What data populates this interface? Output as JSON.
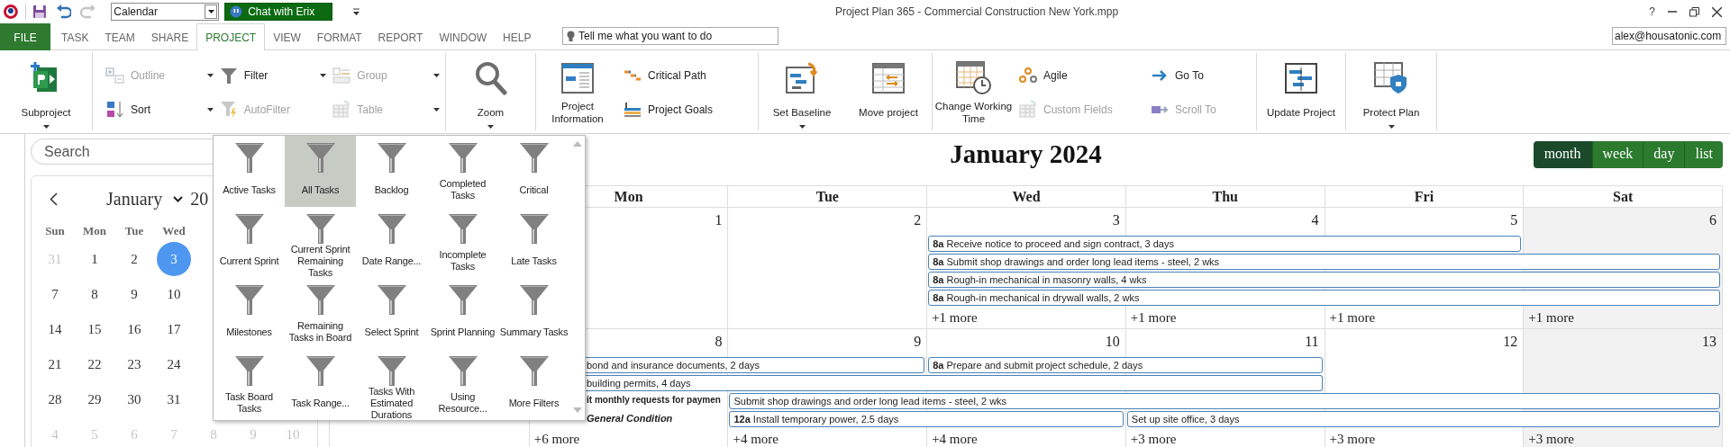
{
  "quick_access": {
    "view_select": {
      "value": "Calendar"
    },
    "chat_button": {
      "label": "Chat with Erix"
    }
  },
  "window": {
    "title": "Project Plan 365 - Commercial Construction New York.mpp",
    "help": "?"
  },
  "tabs": [
    {
      "label": "FILE",
      "kind": "file",
      "selected": false
    },
    {
      "label": "TASK",
      "kind": "tab",
      "selected": false
    },
    {
      "label": "TEAM",
      "kind": "tab",
      "selected": false
    },
    {
      "label": "SHARE",
      "kind": "tab",
      "selected": false
    },
    {
      "label": "PROJECT",
      "kind": "tab",
      "selected": true
    },
    {
      "label": "VIEW",
      "kind": "tab",
      "selected": false
    },
    {
      "label": "FORMAT",
      "kind": "tab",
      "selected": false
    },
    {
      "label": "REPORT",
      "kind": "tab",
      "selected": false
    },
    {
      "label": "WINDOW",
      "kind": "tab",
      "selected": false
    },
    {
      "label": "HELP",
      "kind": "tab",
      "selected": false
    }
  ],
  "tell_me": {
    "placeholder": "Tell me what you want to do"
  },
  "account": {
    "value": "alex@housatonic.com"
  },
  "ribbon": {
    "groups": [
      {
        "items": [
          {
            "label": "Subproject",
            "kind": "large",
            "disabled": false,
            "dropdown": true
          }
        ]
      },
      {
        "items": [
          {
            "label": "Outline",
            "kind": "small",
            "disabled": true,
            "dropdown": true
          },
          {
            "label": "Sort",
            "kind": "small",
            "disabled": false,
            "dropdown": true
          },
          {
            "label": "Filter",
            "kind": "small",
            "disabled": false,
            "dropdown": true
          },
          {
            "label": "AutoFilter",
            "kind": "small",
            "disabled": true,
            "dropdown": false
          },
          {
            "label": "Group",
            "kind": "small",
            "disabled": true,
            "dropdown": true
          },
          {
            "label": "Table",
            "kind": "small",
            "disabled": true,
            "dropdown": true
          }
        ]
      },
      {
        "items": [
          {
            "label": "Zoom",
            "kind": "large",
            "disabled": false,
            "dropdown": true
          }
        ]
      },
      {
        "items": [
          {
            "label": "Project Information",
            "kind": "large",
            "disabled": false,
            "dropdown": false
          },
          {
            "label": "Critical Path",
            "kind": "small",
            "disabled": false,
            "dropdown": false
          },
          {
            "label": "Project Goals",
            "kind": "small",
            "disabled": false,
            "dropdown": false
          }
        ]
      },
      {
        "items": [
          {
            "label": "Set Baseline",
            "kind": "large",
            "disabled": false,
            "dropdown": true
          },
          {
            "label": "Move project",
            "kind": "large",
            "disabled": false,
            "dropdown": false
          }
        ]
      },
      {
        "items": [
          {
            "label": "Change Working Time",
            "kind": "large",
            "disabled": false,
            "dropdown": false
          },
          {
            "label": "Agile",
            "kind": "small",
            "disabled": false,
            "dropdown": false
          },
          {
            "label": "Custom Fields",
            "kind": "small",
            "disabled": true,
            "dropdown": false
          },
          {
            "label": "Go To",
            "kind": "small",
            "disabled": false,
            "dropdown": false
          },
          {
            "label": "Scroll To",
            "kind": "small",
            "disabled": true,
            "dropdown": false
          }
        ]
      },
      {
        "items": [
          {
            "label": "Update Project",
            "kind": "large",
            "disabled": false,
            "dropdown": false
          }
        ]
      },
      {
        "items": [
          {
            "label": "Protect Plan",
            "kind": "large",
            "disabled": false,
            "dropdown": true
          }
        ]
      }
    ]
  },
  "filter_menu": {
    "items": [
      {
        "label": "Active Tasks",
        "selected": false
      },
      {
        "label": "All Tasks",
        "selected": true
      },
      {
        "label": "Backlog",
        "selected": false
      },
      {
        "label": "Completed Tasks",
        "selected": false
      },
      {
        "label": "Critical",
        "selected": false
      },
      {
        "label": "Current Sprint",
        "selected": false
      },
      {
        "label": "Current Sprint Remaining Tasks",
        "selected": false
      },
      {
        "label": "Date Range...",
        "selected": false
      },
      {
        "label": "Incomplete Tasks",
        "selected": false
      },
      {
        "label": "Late Tasks",
        "selected": false
      },
      {
        "label": "Milestones",
        "selected": false
      },
      {
        "label": "Remaining Tasks in Board",
        "selected": false
      },
      {
        "label": "Select Sprint",
        "selected": false
      },
      {
        "label": "Sprint Planning",
        "selected": false
      },
      {
        "label": "Summary Tasks",
        "selected": false
      },
      {
        "label": "Task Board Tasks",
        "selected": false
      },
      {
        "label": "Task Range...",
        "selected": false
      },
      {
        "label": "Tasks With Estimated Durations",
        "selected": false
      },
      {
        "label": "Using Resource...",
        "selected": false
      },
      {
        "label": "More Filters",
        "selected": false
      }
    ]
  },
  "sidebar": {
    "search": {
      "placeholder": "Search"
    },
    "mini_calendar": {
      "month": "January",
      "year": "20",
      "weekdays": [
        "Sun",
        "Mon",
        "Tue",
        "Wed"
      ],
      "weeks": [
        {
          "days": [
            {
              "label": "31",
              "muted": true,
              "selected": false
            },
            {
              "label": "1",
              "muted": false,
              "selected": false
            },
            {
              "label": "2",
              "muted": false,
              "selected": false
            },
            {
              "label": "3",
              "muted": false,
              "selected": true
            }
          ]
        },
        {
          "days": [
            {
              "label": "7",
              "muted": false,
              "selected": false
            },
            {
              "label": "8",
              "muted": false,
              "selected": false
            },
            {
              "label": "9",
              "muted": false,
              "selected": false
            },
            {
              "label": "10",
              "muted": false,
              "selected": false
            }
          ]
        },
        {
          "days": [
            {
              "label": "14",
              "muted": false,
              "selected": false
            },
            {
              "label": "15",
              "muted": false,
              "selected": false
            },
            {
              "label": "16",
              "muted": false,
              "selected": false
            },
            {
              "label": "17",
              "muted": false,
              "selected": false
            }
          ]
        },
        {
          "days": [
            {
              "label": "21",
              "muted": false,
              "selected": false
            },
            {
              "label": "22",
              "muted": false,
              "selected": false
            },
            {
              "label": "23",
              "muted": false,
              "selected": false
            },
            {
              "label": "24",
              "muted": false,
              "selected": false
            }
          ]
        },
        {
          "days": [
            {
              "label": "28",
              "muted": false,
              "selected": false
            },
            {
              "label": "29",
              "muted": false,
              "selected": false
            },
            {
              "label": "30",
              "muted": false,
              "selected": false
            },
            {
              "label": "31",
              "muted": false,
              "selected": false
            }
          ]
        },
        {
          "days": [
            {
              "label": "4",
              "muted": true,
              "selected": false
            },
            {
              "label": "5",
              "muted": true,
              "selected": false
            },
            {
              "label": "6",
              "muted": true,
              "selected": false
            },
            {
              "label": "7",
              "muted": true,
              "selected": false
            },
            {
              "label": "8",
              "muted": true,
              "selected": false
            },
            {
              "label": "9",
              "muted": true,
              "selected": false
            },
            {
              "label": "10",
              "muted": true,
              "selected": false
            }
          ]
        }
      ]
    }
  },
  "calendar": {
    "title": "January 2024",
    "views": [
      {
        "label": "month",
        "selected": true
      },
      {
        "label": "week",
        "selected": false
      },
      {
        "label": "day",
        "selected": false
      },
      {
        "label": "list",
        "selected": false
      }
    ],
    "weekdays": [
      "Mon",
      "Tue",
      "Wed",
      "Thu",
      "Fri",
      "Sat"
    ],
    "weeks": [
      {
        "days": [
          {
            "number": "1",
            "weekend": false
          },
          {
            "number": "2",
            "weekend": false
          },
          {
            "number": "3",
            "weekend": false,
            "more": "+1 more"
          },
          {
            "number": "4",
            "weekend": false,
            "more": "+1 more"
          },
          {
            "number": "5",
            "weekend": false,
            "more": "+1 more"
          },
          {
            "number": "6",
            "weekend": true,
            "more": "+1 more"
          }
        ],
        "lanes": [
          {
            "cells": [
              {
                "kind": "empty"
              },
              {
                "kind": "empty"
              },
              {
                "kind": "empty"
              },
              {
                "kind": "bar",
                "time": "8a",
                "title": "Receive notice to proceed and sign contract, 3 days"
              },
              {
                "kind": "continue"
              },
              {
                "kind": "continue"
              },
              {
                "kind": "empty"
              }
            ]
          },
          {
            "cells": [
              {
                "kind": "empty"
              },
              {
                "kind": "empty"
              },
              {
                "kind": "empty"
              },
              {
                "kind": "bar",
                "time": "8a",
                "title": "Submit shop drawings and order long lead items - steel, 2 wks"
              },
              {
                "kind": "continue"
              },
              {
                "kind": "continue"
              },
              {
                "kind": "continue"
              }
            ]
          },
          {
            "cells": [
              {
                "kind": "empty"
              },
              {
                "kind": "empty"
              },
              {
                "kind": "empty"
              },
              {
                "kind": "bar",
                "time": "8a",
                "title": "Rough-in mechanical in masonry walls, 4 wks"
              },
              {
                "kind": "continue"
              },
              {
                "kind": "continue"
              },
              {
                "kind": "continue"
              }
            ]
          },
          {
            "cells": [
              {
                "kind": "empty"
              },
              {
                "kind": "empty"
              },
              {
                "kind": "empty"
              },
              {
                "kind": "bar",
                "time": "8a",
                "title": "Rough-in mechanical in drywall walls, 2 wks"
              },
              {
                "kind": "continue"
              },
              {
                "kind": "continue"
              },
              {
                "kind": "continue"
              }
            ]
          }
        ]
      },
      {
        "days": [
          {
            "number": "8",
            "weekend": false,
            "more": "+6 more"
          },
          {
            "number": "9",
            "weekend": false,
            "more": "+4 more"
          },
          {
            "number": "10",
            "weekend": false,
            "more": "+4 more"
          },
          {
            "number": "11",
            "weekend": false,
            "more": "+3 more"
          },
          {
            "number": "12",
            "weekend": false,
            "more": "+3 more"
          },
          {
            "number": "13",
            "weekend": true,
            "more": "+3 more"
          }
        ],
        "lanes": [
          {
            "cells": [
              {
                "kind": "bar",
                "title": "bond and insurance documents, 2 days"
              },
              {
                "kind": "continue"
              },
              {
                "kind": "continue"
              },
              {
                "kind": "bar",
                "time": "8a",
                "title": "Prepare and submit project schedule, 2 days"
              },
              {
                "kind": "continue"
              },
              {
                "kind": "empty"
              },
              {
                "kind": "empty"
              }
            ]
          },
          {
            "cells": [
              {
                "kind": "bar",
                "title": "building permits, 4 days"
              },
              {
                "kind": "continue"
              },
              {
                "kind": "continue"
              },
              {
                "kind": "continue"
              },
              {
                "kind": "continue"
              },
              {
                "kind": "empty"
              },
              {
                "kind": "empty"
              }
            ]
          },
          {
            "cells": [
              {
                "kind": "bold",
                "title": "it monthly requests for paymen"
              },
              {
                "kind": "continue"
              },
              {
                "kind": "bar",
                "title": "Submit shop drawings and order long lead items - steel, 2 wks"
              },
              {
                "kind": "continue"
              },
              {
                "kind": "continue"
              },
              {
                "kind": "continue"
              },
              {
                "kind": "continue"
              }
            ]
          },
          {
            "cells": [
              {
                "kind": "bold-italic",
                "title": "General Condition"
              },
              {
                "kind": "continue"
              },
              {
                "kind": "bar",
                "time": "12a",
                "title": "Install temporary power, 2.5 days"
              },
              {
                "kind": "continue"
              },
              {
                "kind": "bar",
                "title": "Set up site office, 3 days"
              },
              {
                "kind": "continue"
              },
              {
                "kind": "continue"
              }
            ]
          }
        ]
      }
    ]
  }
}
